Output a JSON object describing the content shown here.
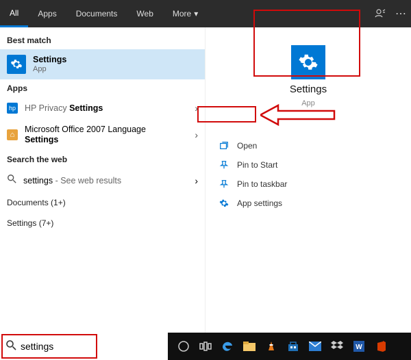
{
  "tabs": {
    "all": "All",
    "apps": "Apps",
    "documents": "Documents",
    "web": "Web",
    "more": "More"
  },
  "left": {
    "best_match": "Best match",
    "settings": {
      "name": "Settings",
      "sub": "App"
    },
    "apps_header": "Apps",
    "hp": {
      "prefix": "HP Privacy ",
      "bold": "Settings"
    },
    "office": {
      "line1": "Microsoft Office 2007 Language",
      "bold": "Settings"
    },
    "search_web": "Search the web",
    "web": {
      "term": "settings",
      "hint": " - See web results"
    },
    "documents_more": "Documents (1+)",
    "settings_more": "Settings (7+)"
  },
  "right": {
    "title": "Settings",
    "sub": "App",
    "actions": {
      "open": "Open",
      "pin_start": "Pin to Start",
      "pin_taskbar": "Pin to taskbar",
      "app_settings": "App settings"
    }
  },
  "taskbar": {
    "search_value": "settings"
  },
  "annotations": {
    "red1": true,
    "red2": true,
    "arrow": true,
    "red3": true
  }
}
